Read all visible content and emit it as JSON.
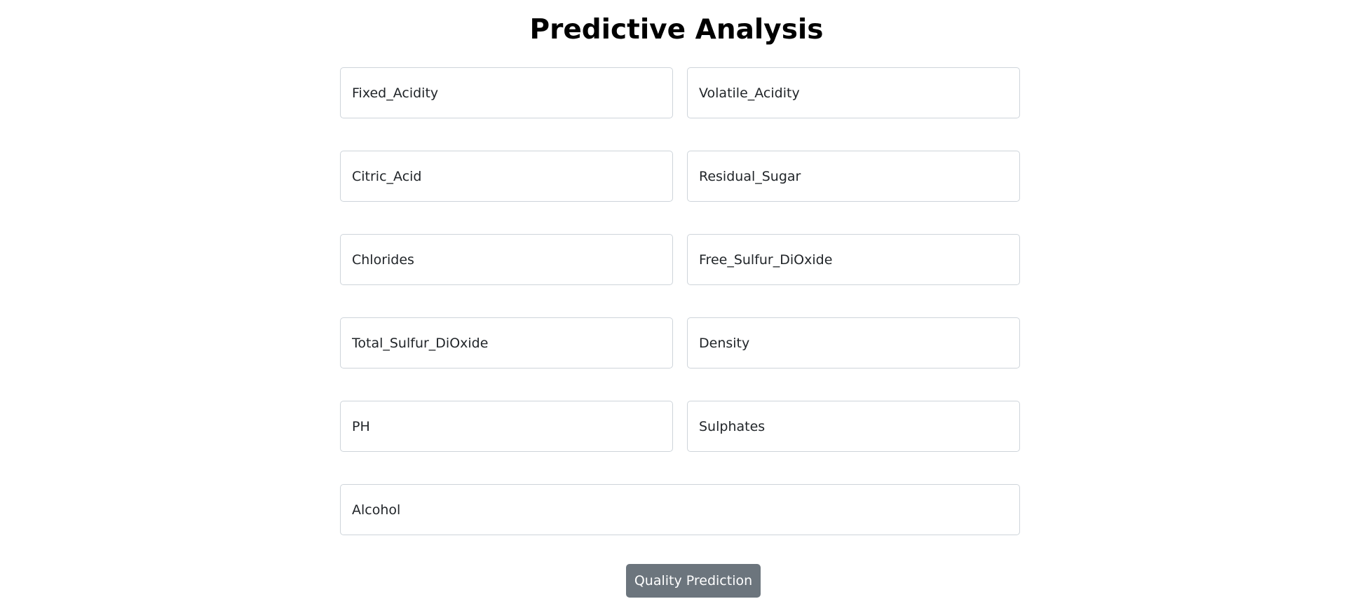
{
  "page": {
    "title": "Predictive Analysis"
  },
  "form": {
    "fields": [
      {
        "placeholder": "Fixed_Acidity",
        "value": ""
      },
      {
        "placeholder": "Volatile_Acidity",
        "value": ""
      },
      {
        "placeholder": "Citric_Acid",
        "value": ""
      },
      {
        "placeholder": "Residual_Sugar",
        "value": ""
      },
      {
        "placeholder": "Chlorides",
        "value": ""
      },
      {
        "placeholder": "Free_Sulfur_DiOxide",
        "value": ""
      },
      {
        "placeholder": "Total_Sulfur_DiOxide",
        "value": ""
      },
      {
        "placeholder": "Density",
        "value": ""
      },
      {
        "placeholder": "PH",
        "value": ""
      },
      {
        "placeholder": "Sulphates",
        "value": ""
      },
      {
        "placeholder": "Alcohol",
        "value": ""
      }
    ],
    "submit_label": "Quality Prediction"
  },
  "colors": {
    "button_bg": "#6c757d",
    "input_border": "#ced4da",
    "text": "#212529"
  }
}
